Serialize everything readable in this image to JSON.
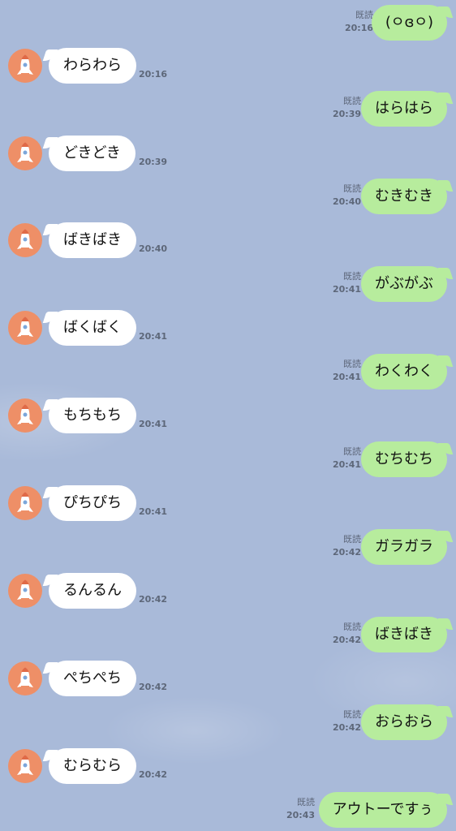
{
  "chat": {
    "read_label": "既読",
    "messages": [
      {
        "side": "out",
        "text": "(ㅇɞㅇ)",
        "time": "20:16",
        "read": true
      },
      {
        "side": "in",
        "text": "わらわら",
        "time": "20:16"
      },
      {
        "side": "out",
        "text": "はらはら",
        "time": "20:39",
        "read": true
      },
      {
        "side": "in",
        "text": "どきどき",
        "time": "20:39"
      },
      {
        "side": "out",
        "text": "むきむき",
        "time": "20:40",
        "read": true
      },
      {
        "side": "in",
        "text": "ばきばき",
        "time": "20:40"
      },
      {
        "side": "out",
        "text": "がぶがぶ",
        "time": "20:41",
        "read": true
      },
      {
        "side": "in",
        "text": "ばくばく",
        "time": "20:41"
      },
      {
        "side": "out",
        "text": "わくわく",
        "time": "20:41",
        "read": true
      },
      {
        "side": "in",
        "text": "もちもち",
        "time": "20:41"
      },
      {
        "side": "out",
        "text": "むちむち",
        "time": "20:41",
        "read": true
      },
      {
        "side": "in",
        "text": "ぴちぴち",
        "time": "20:41"
      },
      {
        "side": "out",
        "text": "ガラガラ",
        "time": "20:42",
        "read": true
      },
      {
        "side": "in",
        "text": "るんるん",
        "time": "20:42"
      },
      {
        "side": "out",
        "text": "ばきばき",
        "time": "20:42",
        "read": true
      },
      {
        "side": "in",
        "text": "ぺちぺち",
        "time": "20:42"
      },
      {
        "side": "out",
        "text": "おらおら",
        "time": "20:42",
        "read": true
      },
      {
        "side": "in",
        "text": "むらむら",
        "time": "20:42"
      },
      {
        "side": "out",
        "text": "アウトーですぅ",
        "time": "20:43",
        "read": true
      }
    ]
  },
  "avatar": {
    "icon": "rocket-icon",
    "background": "#ee8f67"
  },
  "colors": {
    "background": "#a9bad9",
    "sent_bubble": "#b7ec9d",
    "received_bubble": "#ffffff",
    "meta_text": "#5d6779"
  }
}
